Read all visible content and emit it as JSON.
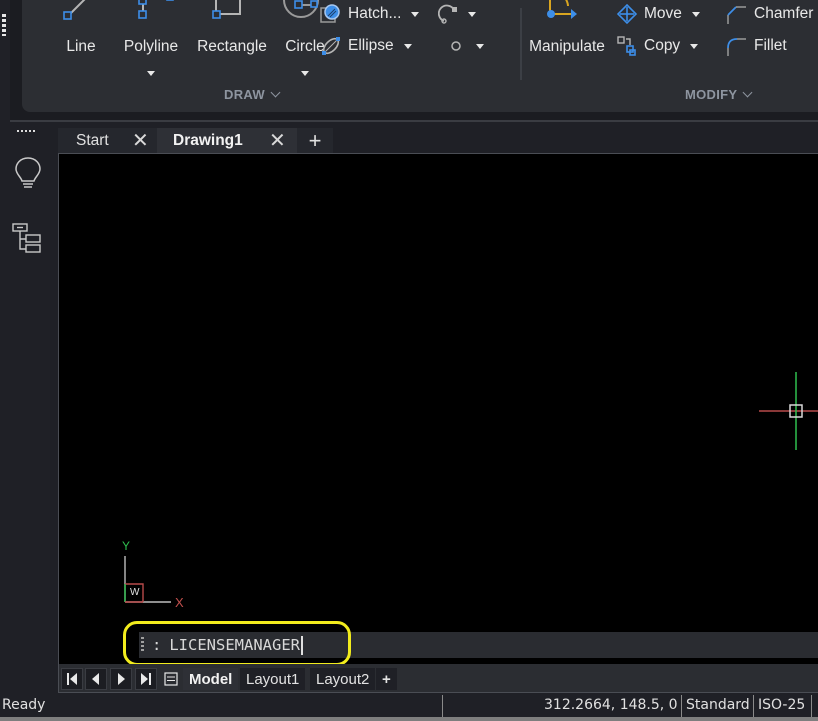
{
  "ribbon": {
    "draw": {
      "section_label": "DRAW",
      "big_buttons": [
        {
          "label": "Line",
          "icon": "line-icon"
        },
        {
          "label": "Polyline",
          "icon": "polyline-icon",
          "has_dropdown": true
        },
        {
          "label": "Rectangle",
          "icon": "rectangle-icon"
        },
        {
          "label": "Circle",
          "icon": "circle-icon",
          "has_dropdown": true
        }
      ],
      "small_buttons": [
        {
          "label": "Hatch...",
          "icon": "hatch-icon",
          "has_dropdown": true
        },
        {
          "label": "Ellipse",
          "icon": "ellipse-icon",
          "has_dropdown": true
        }
      ],
      "icon_buttons": [
        {
          "icon": "arc-icon",
          "has_dropdown": true
        },
        {
          "icon": "point-icon",
          "has_dropdown": true
        }
      ]
    },
    "modify": {
      "section_label": "MODIFY",
      "big_buttons": [
        {
          "label": "Manipulate",
          "icon": "manipulate-icon"
        }
      ],
      "small_buttons": [
        {
          "label": "Move",
          "icon": "move-icon",
          "has_dropdown": true
        },
        {
          "label": "Copy",
          "icon": "copy-icon",
          "has_dropdown": true
        },
        {
          "label": "Chamfer",
          "icon": "chamfer-icon"
        },
        {
          "label": "Fillet",
          "icon": "fillet-icon"
        }
      ]
    }
  },
  "side_toolbar": {
    "items": [
      {
        "icon": "lightbulb-icon"
      },
      {
        "icon": "structure-tree-icon"
      }
    ]
  },
  "document_tabs": [
    {
      "label": "Start",
      "close": "✕"
    },
    {
      "label": "Drawing1",
      "close": "✕",
      "active": true
    }
  ],
  "add_tab_label": "+",
  "canvas": {
    "ucs": {
      "x_label": "X",
      "y_label": "Y",
      "w_label": "W"
    },
    "command_line": {
      "prompt": ":",
      "value": "LICENSEMANAGER"
    }
  },
  "layout_tabs": {
    "items": [
      "Model",
      "Layout1",
      "Layout2"
    ],
    "active": "Model",
    "add_label": "+"
  },
  "status_bar": {
    "status": "Ready",
    "coordinates": "312.2664, 148.5, 0",
    "text_style": "Standard",
    "dim_style": "ISO-25"
  },
  "colors": {
    "accent_blue": "#3d8ee8",
    "highlight_yellow": "#f2ec1d",
    "axis_x_red": "#b84a4a",
    "axis_y_green": "#2fbf4f"
  }
}
